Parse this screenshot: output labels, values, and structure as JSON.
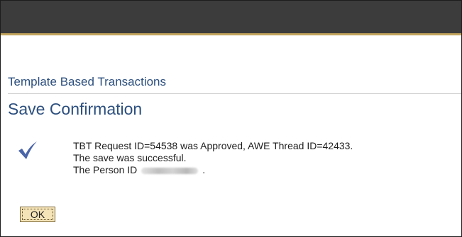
{
  "breadcrumb": {
    "title": "Template Based Transactions"
  },
  "page": {
    "title": "Save Confirmation"
  },
  "messages": {
    "line1": "TBT Request ID=54538 was Approved, AWE Thread ID=42433.",
    "line2": "The save was successful.",
    "line3_prefix": "The Person ID",
    "line3_suffix": "."
  },
  "icons": {
    "success": "checkmark-icon"
  },
  "actions": {
    "ok_label": "OK"
  },
  "colors": {
    "header_bar": "#3c3c3c",
    "header_accent": "#c4a55e",
    "title_text": "#2c4f7e",
    "checkmark": "#4a65a8",
    "ok_button_bg": "#f6e4b9"
  }
}
